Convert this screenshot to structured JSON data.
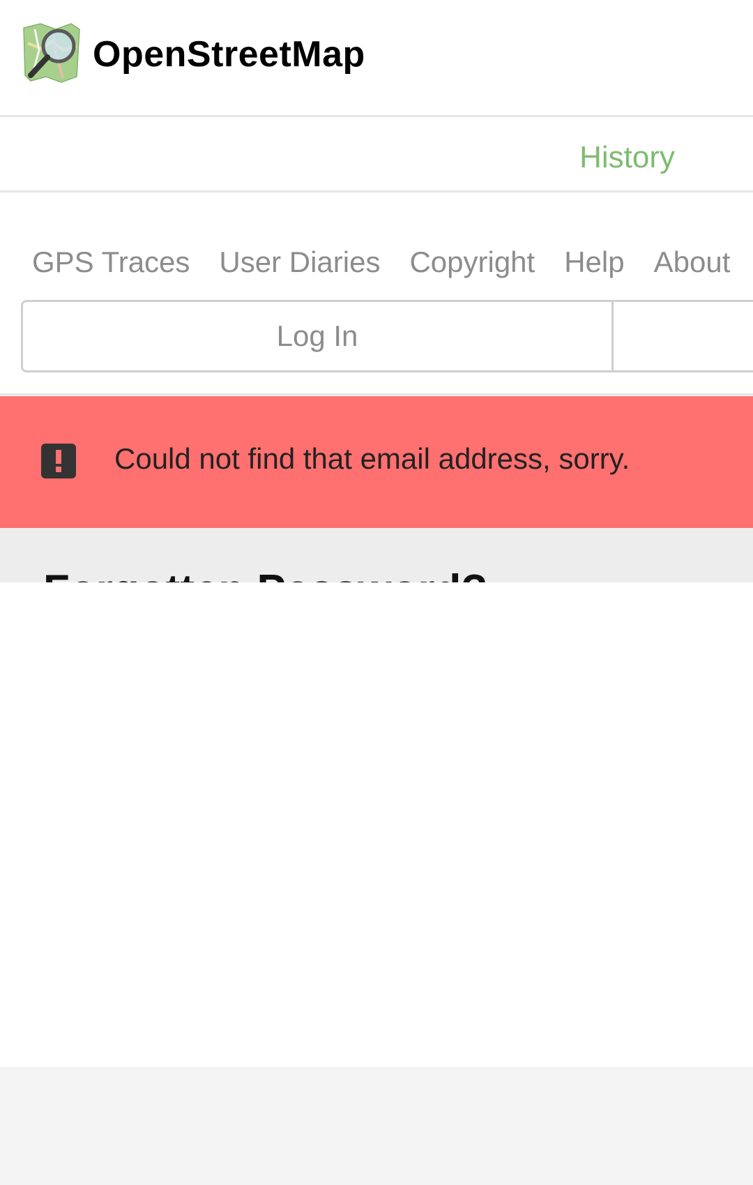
{
  "header": {
    "site_title": "OpenStreetMap",
    "logo_icon": "osm-magnifier-map-logo"
  },
  "tabs": {
    "history_label": "History",
    "accent_color": "#7ebc6f"
  },
  "nav": {
    "items": [
      {
        "label": "GPS Traces"
      },
      {
        "label": "User Diaries"
      },
      {
        "label": "Copyright"
      },
      {
        "label": "Help"
      },
      {
        "label": "About"
      }
    ]
  },
  "auth": {
    "login_label": "Log In"
  },
  "flash": {
    "icon": "exclamation-icon",
    "message": "Could not find that email address, sorry.",
    "background_color": "#ff7070"
  },
  "main": {
    "heading": "Forgotten Password?"
  }
}
